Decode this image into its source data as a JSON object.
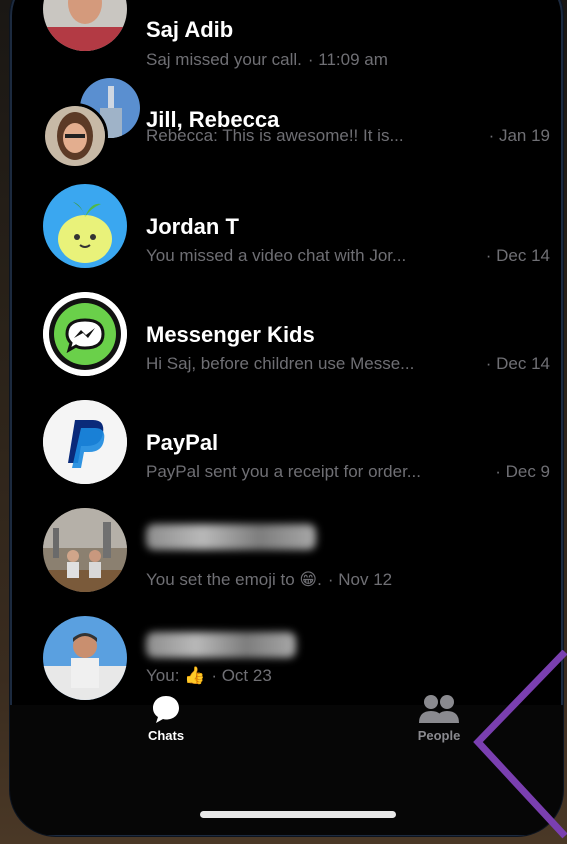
{
  "chats": [
    {
      "name": "Saj Adib",
      "preview": "Saj missed your call.",
      "time": "· 11:09 am"
    },
    {
      "name": "Jill, Rebecca",
      "preview": "Rebecca: This is awesome!! It is...",
      "time": "· Jan 19"
    },
    {
      "name": "Jordan T",
      "preview": "You missed a video chat with Jor...",
      "time": "· Dec 14"
    },
    {
      "name": "Messenger Kids",
      "preview": "Hi Saj, before children use Messe...",
      "time": "· Dec 14"
    },
    {
      "name": "PayPal",
      "preview": "PayPal sent you a receipt for order...",
      "time": "· Dec 9"
    },
    {
      "name": "",
      "preview": "You set the emoji to 😁.",
      "time": "· Nov 12"
    },
    {
      "name": "",
      "preview": "You: 👍",
      "time": "· Oct 23"
    }
  ],
  "tabs": {
    "chats_label": "Chats",
    "people_label": "People"
  },
  "colors": {
    "active_tab": "#ffffff",
    "inactive_tab": "#8a8a8f",
    "preview_text": "#6f6f74",
    "annotation": "#7a3fb0"
  }
}
